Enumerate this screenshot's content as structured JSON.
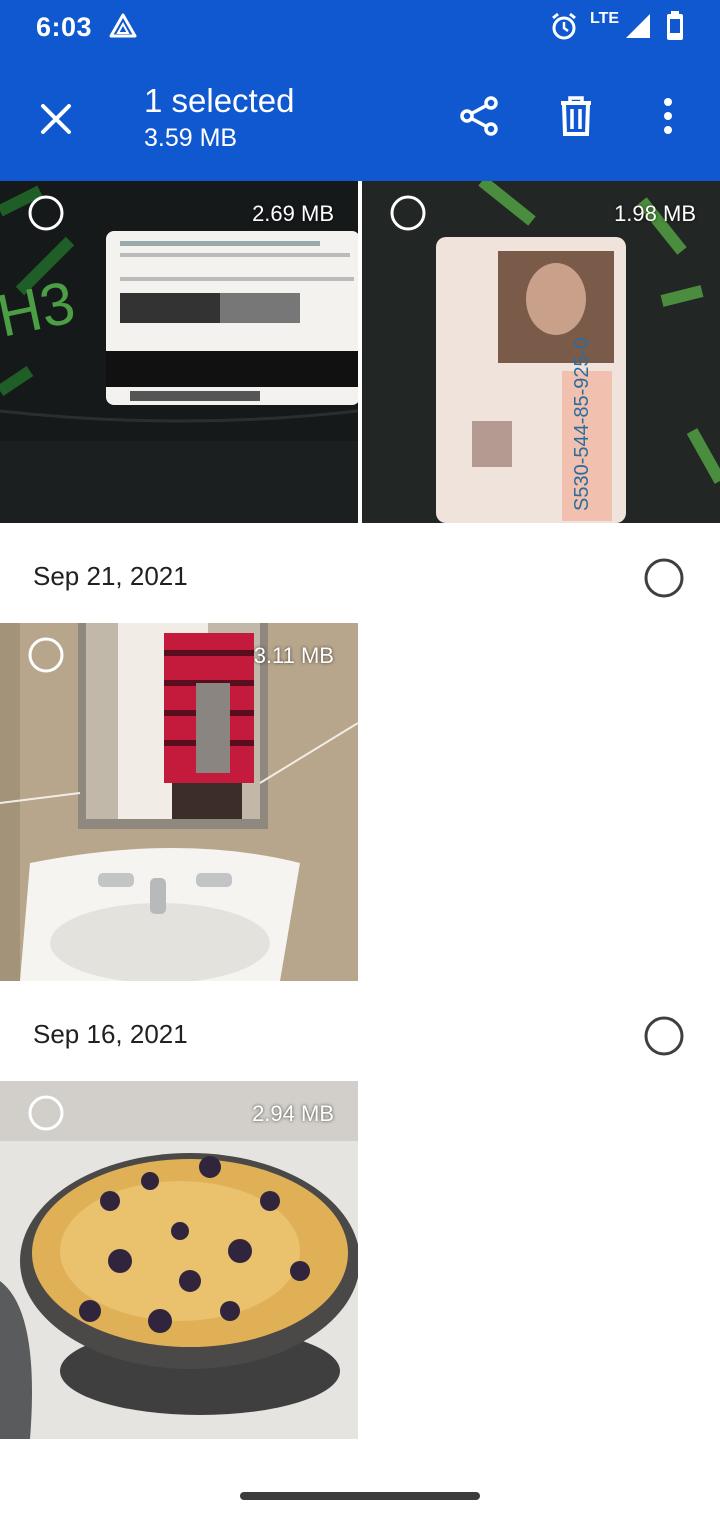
{
  "status_bar": {
    "time": "6:03",
    "network": "LTE"
  },
  "selection_bar": {
    "title": "1 selected",
    "subtitle": "3.59 MB"
  },
  "groups": [
    {
      "date": "",
      "items": [
        {
          "size": "2.69 MB",
          "subject": "ID card back"
        },
        {
          "size": "1.98 MB",
          "subject": "ID card front"
        }
      ]
    },
    {
      "date": "Sep 21, 2021",
      "items": [
        {
          "size": "3.11 MB",
          "subject": "bathroom mirror selfie"
        }
      ]
    },
    {
      "date": "Sep 16, 2021",
      "items": [
        {
          "size": "2.94 MB",
          "subject": "berry cobbler"
        }
      ]
    }
  ],
  "colors": {
    "appbar": "#1058cf",
    "background": "#ffffff",
    "accent_green": "#5cb84a"
  }
}
